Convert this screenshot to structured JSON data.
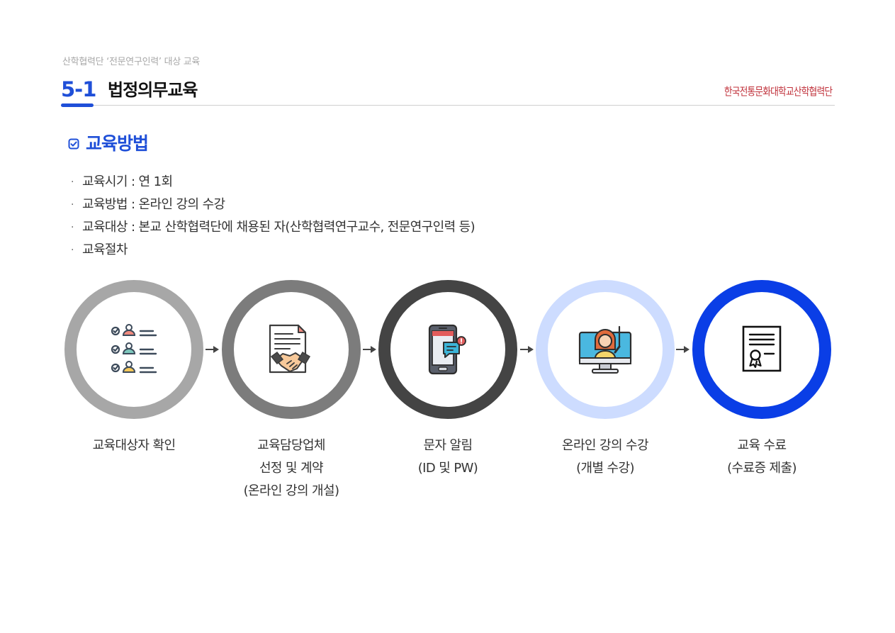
{
  "breadcrumb": "산학협력단 ‘전문연구인력’ 대상 교육",
  "header": {
    "section_number": "5-1",
    "section_title": "법정의무교육",
    "brand": "한국전통문화대학교산학협력단"
  },
  "subheading": "교육방법",
  "bullets": [
    "교육시기 : 연 1회",
    "교육방법 : 온라인 강의 수강",
    "교육대상 : 본교 산학협력단에 채용된 자(산학협력연구교수, 전문연구인력 등)",
    "교육절차"
  ],
  "colors": {
    "accent": "#1f4fd8",
    "ring_1": "#a7a7a7",
    "ring_2": "#7c7c7c",
    "ring_3": "#444444",
    "ring_4": "#cddcff",
    "ring_5": "#0a3ee6",
    "brand": "#c0303a"
  },
  "steps": [
    {
      "icon": "checklist-people-icon",
      "lines": [
        "교육대상자 확인"
      ]
    },
    {
      "icon": "contract-handshake-icon",
      "lines": [
        "교육담당업체",
        "선정 및 계약",
        "(온라인 강의 개설)"
      ]
    },
    {
      "icon": "smartphone-message-icon",
      "lines": [
        "문자 알림",
        "(ID 및 PW)"
      ]
    },
    {
      "icon": "online-lecture-icon",
      "lines": [
        "온라인 강의 수강",
        "(개별 수강)"
      ]
    },
    {
      "icon": "certificate-icon",
      "lines": [
        "교육 수료",
        "(수료증 제출)"
      ]
    }
  ]
}
